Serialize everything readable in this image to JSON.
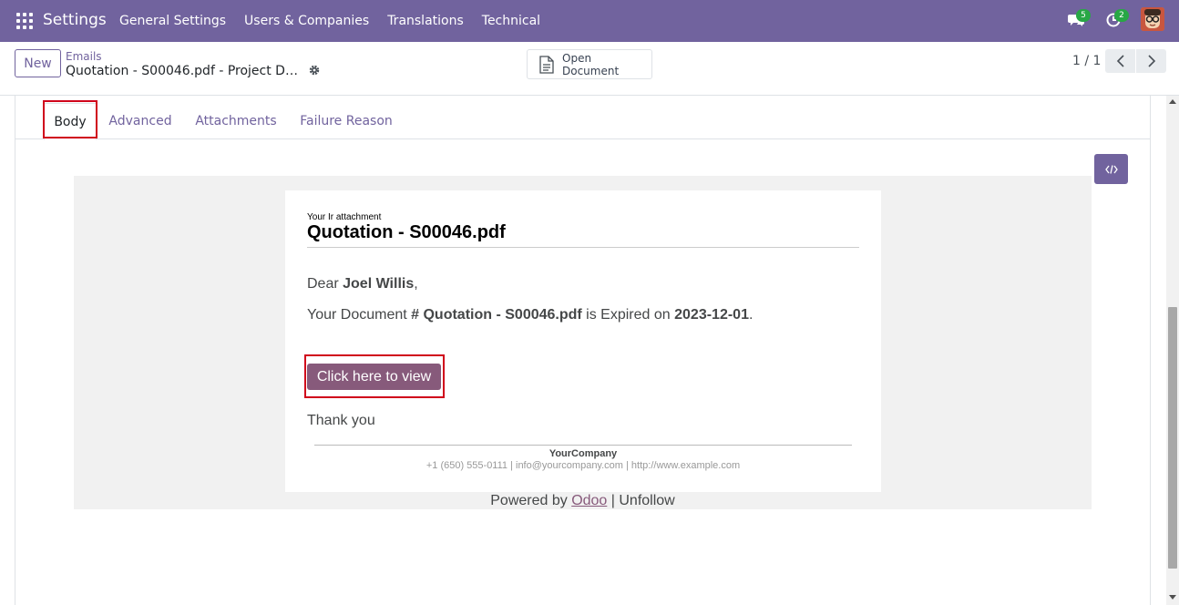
{
  "navbar": {
    "brand": "Settings",
    "menu": [
      "General Settings",
      "Users & Companies",
      "Translations",
      "Technical"
    ],
    "messages_count": "5",
    "activities_count": "2",
    "icons": {
      "apps": "apps-grid-icon",
      "messages": "chat-icon",
      "activities": "clock-icon",
      "user": "user-avatar"
    }
  },
  "control_panel": {
    "new_label": "New",
    "breadcrumb_parent": "Emails",
    "breadcrumb_current": "Quotation - S00046.pdf - Project Docu...",
    "open_document_label": "Open Document",
    "pager_value": "1 / 1"
  },
  "tabs": [
    "Body",
    "Advanced",
    "Attachments",
    "Failure Reason"
  ],
  "active_tab": "Body",
  "email": {
    "doc_label": "Your Ir attachment",
    "doc_title": "Quotation - S00046.pdf",
    "greeting_prefix": "Dear ",
    "greeting_name": "Joel Willis",
    "greeting_suffix": ",",
    "line_prefix": "Your Document ",
    "line_doc": "# Quotation - S00046.pdf",
    "line_mid": " is Expired on ",
    "line_date": "2023-12-01",
    "line_suffix": ".",
    "button_label": "Click here to view",
    "thanks": "Thank you",
    "company": "YourCompany",
    "contact": "+1 (650) 555-0111 | info@yourcompany.com | http://www.example.com",
    "powered_prefix": "Powered by ",
    "powered_link": "Odoo",
    "powered_sep": " | ",
    "unfollow": "Unfollow"
  },
  "colors": {
    "navbar": "#71639e",
    "accent": "#71639e",
    "email_button": "#875a7b",
    "badge": "#28a745",
    "highlight": "#d0021b"
  }
}
